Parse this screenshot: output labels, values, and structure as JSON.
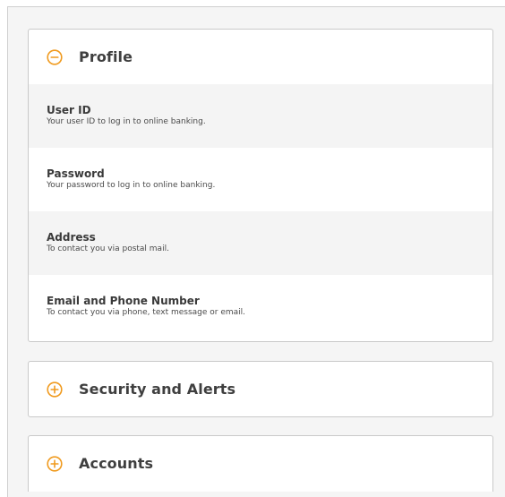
{
  "colors": {
    "accent": "#f09a1e",
    "title_text": "#3f3f3f",
    "panel_border": "#c9c9c9",
    "row_shade": "#f4f4f4",
    "page_background": "#f5f5f5"
  },
  "profile": {
    "title": "Profile",
    "icon": "minus-circle-icon",
    "expanded": true,
    "items": [
      {
        "title": "User ID",
        "description": "Your user ID to log in to online banking."
      },
      {
        "title": "Password",
        "description": "Your password to log in to online banking."
      },
      {
        "title": "Address",
        "description": "To contact you via postal mail."
      },
      {
        "title": "Email and Phone Number",
        "description": "To contact you via phone, text message or email."
      }
    ]
  },
  "security": {
    "title": "Security and Alerts",
    "icon": "plus-circle-icon",
    "expanded": false
  },
  "accounts": {
    "title": "Accounts",
    "icon": "plus-circle-icon",
    "expanded": false
  }
}
